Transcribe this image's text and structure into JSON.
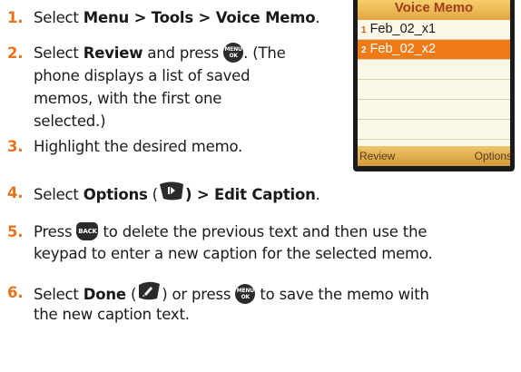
{
  "steps": [
    {
      "num": "1.",
      "parts": [
        "Select ",
        "Menu > Tools > Voice Memo",
        "."
      ]
    },
    {
      "num": "2.",
      "line1": [
        "Select ",
        "Review",
        " and press ",
        ". (The"
      ],
      "line2": "phone displays a list of saved",
      "line3": "memos, with the first one",
      "line4": "selected.)"
    },
    {
      "num": "3.",
      "text": "Highlight the desired memo."
    },
    {
      "num": "4.",
      "parts": [
        "Select ",
        "Options",
        " (",
        ") > Edit Caption",
        "."
      ]
    },
    {
      "num": "5.",
      "line1": [
        "Press ",
        " to delete the previous text and then use the"
      ],
      "line2": "keypad to enter a new caption for the selected memo."
    },
    {
      "num": "6.",
      "line1": [
        "Select ",
        "Done",
        " (",
        ") or press ",
        " to save the memo with"
      ],
      "line2": "the new caption text."
    }
  ],
  "icons": {
    "menu_ok": "MENU OK",
    "menu_ok_top": "MENU",
    "menu_ok_bottom": "OK",
    "back": "BACK",
    "options_key": "right-softkey-icon",
    "done_key": "left-softkey-icon"
  },
  "phone": {
    "title": "Voice Memo",
    "memos": [
      {
        "index": "1",
        "name": "Feb_02_x1",
        "selected": false
      },
      {
        "index": "2",
        "name": "Feb_02_x2",
        "selected": true
      }
    ],
    "softkey_left": "Review",
    "softkey_right": "Options"
  },
  "colors": {
    "step_number": "#e8731a",
    "phone_title_bg": "#e3a640",
    "selected_row": "#ef7a18"
  }
}
